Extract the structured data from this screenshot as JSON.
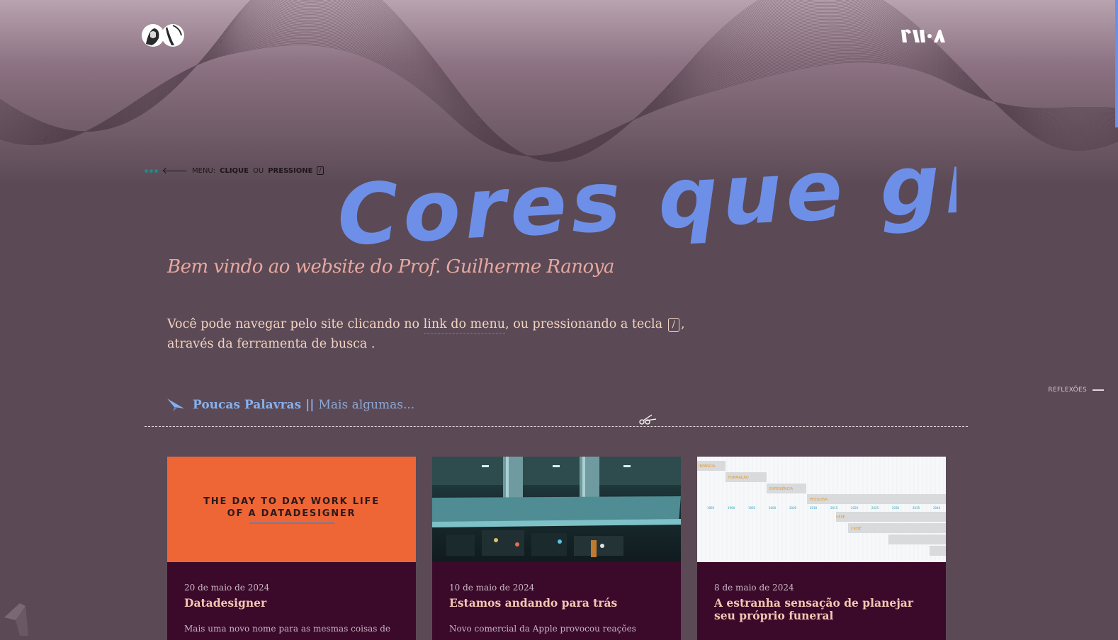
{
  "header": {
    "logo_icon": "portrait-logo-icon",
    "brand_icon": "rma-brand-icon"
  },
  "menu_hint": {
    "prefix": "MENU:",
    "click": "CLIQUE",
    "or": "OU",
    "press": "PRESSIONE",
    "key": "/"
  },
  "hero": {
    "title": "Cores que gritam",
    "subtitle": "Bem vindo ao website do Prof. Guilherme Ranoya"
  },
  "intro": {
    "part1": "Você pode navegar pelo site clicando no ",
    "menu_link": "link do menu",
    "part2": ", ou pressionando a tecla ",
    "key": "/",
    "part3": ", através da ferramenta de busca ."
  },
  "side_nav": {
    "label": "REFLEXÕES"
  },
  "section": {
    "active_tab": "Poucas Palavras",
    "separator": "||",
    "other_tab": "Mais algumas..."
  },
  "cards": [
    {
      "image_text": "THE DAY TO DAY WORK LIFE OF A DATADESIGNER",
      "date": "20 de maio de 2024",
      "title": "Datadesigner",
      "excerpt": "Mais uma novo nome para as mesmas coisas de"
    },
    {
      "date": "10 de maio de 2024",
      "title": "Estamos andando para trás",
      "excerpt": "Novo comercial da Apple provocou reações"
    },
    {
      "gantt_labels": [
        "INFÂNCIA",
        "FORMAÇÃO",
        "EXPERIÊNCIA",
        "PESQUISA",
        "UFPE",
        "CRISE"
      ],
      "gantt_years": [
        "1985",
        "1990",
        "1995",
        "2000",
        "2005",
        "2010",
        "2015",
        "2020",
        "2025",
        "2030",
        "2035",
        "2040"
      ],
      "date": "8 de maio de 2024",
      "title": "A estranha sensação de planejar seu próprio funeral"
    }
  ],
  "colors": {
    "background": "#5b4a55",
    "hero_title": "#6e8fe8",
    "subtitle": "#e8a8a0",
    "card_bg": "#3b0a2b",
    "card_title": "#f4c7b2",
    "accent_blue": "#86b0ee"
  }
}
